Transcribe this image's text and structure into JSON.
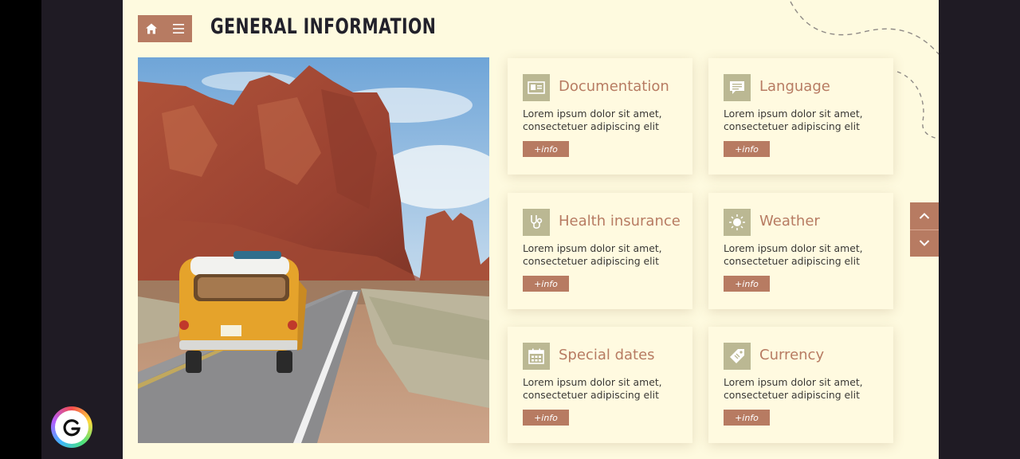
{
  "header": {
    "title": "GENERAL INFORMATION",
    "home_icon": "home-icon",
    "menu_icon": "menu-icon"
  },
  "cards": [
    {
      "icon": "id-card-icon",
      "title": "Documentation",
      "text": "Lorem ipsum dolor sit amet, consectetuer adipiscing elit",
      "button": "+info"
    },
    {
      "icon": "chat-bubble-icon",
      "title": "Language",
      "text": "Lorem ipsum dolor sit amet, consectetuer adipiscing elit",
      "button": "+info"
    },
    {
      "icon": "stethoscope-icon",
      "title": "Health insurance",
      "text": "Lorem ipsum dolor sit amet, consectetuer adipiscing elit",
      "button": "+info"
    },
    {
      "icon": "sun-icon",
      "title": "Weather",
      "text": "Lorem ipsum dolor sit amet, consectetuer adipiscing elit",
      "button": "+info"
    },
    {
      "icon": "calendar-icon",
      "title": "Special dates",
      "text": "Lorem ipsum dolor sit amet, consectetuer adipiscing elit",
      "button": "+info"
    },
    {
      "icon": "money-tag-icon",
      "title": "Currency",
      "text": "Lorem ipsum dolor sit amet, consectetuer adipiscing elit",
      "button": "+info"
    }
  ],
  "scroll_controls": {
    "up_icon": "chevron-up-icon",
    "down_icon": "chevron-down-icon"
  },
  "colors": {
    "accent": "#b77b62",
    "icon_bg": "#bbb893",
    "slide_bg": "#fefadf",
    "card_bg": "#fffae0",
    "title_text": "#22212b"
  }
}
